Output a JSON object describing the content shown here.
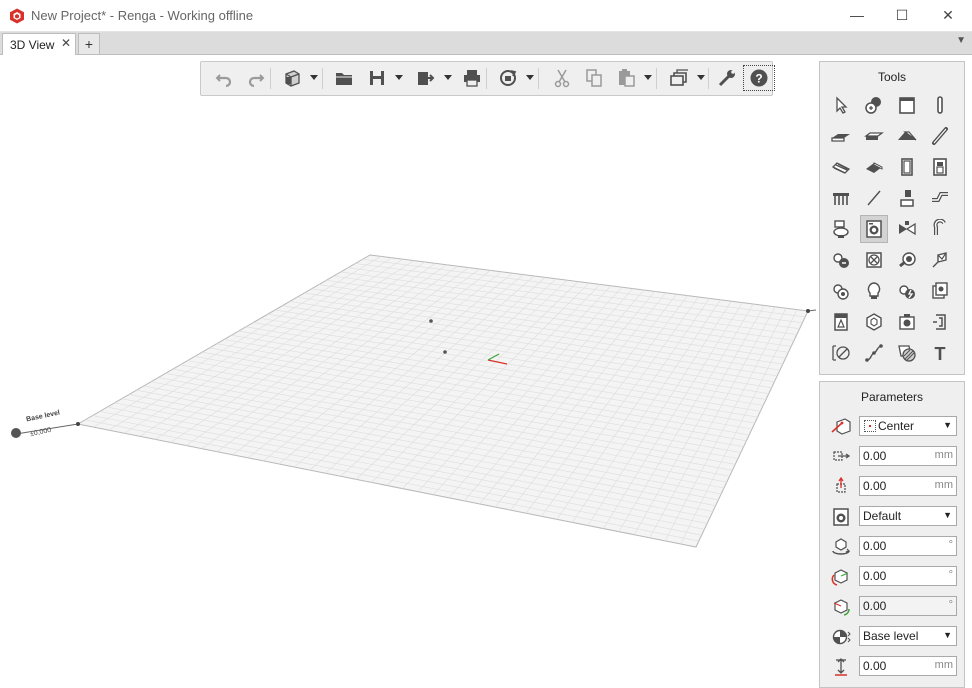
{
  "window": {
    "title": "New Project* - Renga - Working offline",
    "minimize_glyph": "—",
    "maximize_glyph": "☐",
    "close_glyph": "✕"
  },
  "tabs": {
    "active_label": "3D View",
    "close_glyph": "✕",
    "add_glyph": "+",
    "menu_glyph": "▼"
  },
  "toolbar": {
    "buttons": [
      "undo-icon",
      "redo-icon",
      "view-cube-icon",
      "open-folder-icon",
      "save-icon",
      "export-icon",
      "print-icon",
      "sync-icon",
      "cut-icon",
      "copy-icon",
      "paste-icon",
      "layers-icon",
      "settings-wrench-icon",
      "help-icon"
    ],
    "help_glyph": "?"
  },
  "tools_panel": {
    "title": "Tools",
    "icons": [
      "select-icon",
      "annotation-icon",
      "wall-icon",
      "column-icon",
      "floor-icon",
      "roof-slab-icon",
      "roof-icon",
      "beam-icon",
      "stair-icon",
      "ramp-icon",
      "door-icon",
      "window-icon",
      "railing-icon",
      "line-icon",
      "plumbing-fixture-icon",
      "duct-icon",
      "toilet-icon",
      "equipment-icon",
      "valve-icon",
      "pipe-icon",
      "pump-icon",
      "fan-icon",
      "fitting-icon",
      "duct-fitting-icon",
      "mechanical-icon",
      "lighting-icon",
      "electrical-icon",
      "cabinet-icon",
      "panel-icon",
      "body-icon",
      "assembly-icon",
      "opening-icon",
      "dimension-icon",
      "route-icon",
      "hatch-icon",
      "text-icon"
    ],
    "active_index": 17,
    "text_tool_glyph": "T"
  },
  "parameters_panel": {
    "title": "Parameters",
    "rows": [
      {
        "icon": "placement-icon",
        "value": "Center",
        "unit": "",
        "kind": "dropdown"
      },
      {
        "icon": "offset-x-icon",
        "value": "0.00",
        "unit": "mm",
        "kind": "number"
      },
      {
        "icon": "offset-y-icon",
        "value": "0.00",
        "unit": "mm",
        "kind": "number"
      },
      {
        "icon": "style-icon",
        "value": "Default",
        "unit": "",
        "kind": "dropdown"
      },
      {
        "icon": "rotation-icon",
        "value": "0.00",
        "unit": "°",
        "kind": "number"
      },
      {
        "icon": "rotation-x-icon",
        "value": "0.00",
        "unit": "°",
        "kind": "number"
      },
      {
        "icon": "rotation-y-icon",
        "value": "0.00",
        "unit": "°",
        "kind": "disabled"
      },
      {
        "icon": "level-icon",
        "value": "Base level",
        "unit": "",
        "kind": "dropdown"
      },
      {
        "icon": "elevation-icon",
        "value": "0.00",
        "unit": "mm",
        "kind": "number"
      }
    ],
    "dropdown_glyph": "▼"
  },
  "viewport": {
    "level_name": "Base level",
    "level_elevation": "±0,000"
  },
  "colors": {
    "accent_red": "#d9322b",
    "panel_bg": "#efefef",
    "grid_line": "#dddddd",
    "icon_gray": "#505050"
  }
}
